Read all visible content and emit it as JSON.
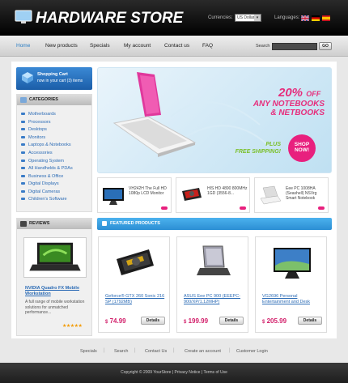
{
  "header": {
    "title": "HARDWARE STORE",
    "currencies_label": "Currencies:",
    "currency_value": "US Dollar",
    "languages_label": "Languages:"
  },
  "nav": {
    "items": [
      "Home",
      "New products",
      "Specials",
      "My account",
      "Contact us",
      "FAQ"
    ],
    "search_label": "Search",
    "search_button": "GO"
  },
  "cart": {
    "title": "Shopping Cart",
    "subtitle": "now in your cart (3) items"
  },
  "categories": {
    "title": "CATEGORIES",
    "items": [
      "Motherboards",
      "Processors",
      "Desktops",
      "Monitors",
      "Laptops & Notebooks",
      "Accessories",
      "Operating System",
      "All Handhelds & PDAs",
      "Business & Office",
      "Digital Displays",
      "Digital Cameras",
      "Children's Software"
    ]
  },
  "reviews": {
    "title": "REVIEWS",
    "product_title": "NVIDIA Quadro FX Mobile Workstation",
    "text": "A full range of mobile workstation solutions for unmatched performance...",
    "stars": "★★★★★"
  },
  "banner": {
    "percent": "20%",
    "off": "OFF",
    "line1": "ANY NOTEBOOKS",
    "line2": "& NETBOOKS",
    "free_line1": "PLUS",
    "free_line2": "FREE SHIPPING!",
    "shop_now": "SHOP NOW!"
  },
  "mini_products": [
    {
      "text": "VH242H The Full HD 1080p LCD Monitor"
    },
    {
      "text": "HIS HD 4890 800MHz 1GD (3556-8..."
    },
    {
      "text": "Eee PC 1008HA (Seashell) NSVrg Smart Notebook"
    }
  ],
  "featured": {
    "title": "FEATURED PRODUCTS",
    "details_label": "Details",
    "products": [
      {
        "name": "Geforce® GTX 260 Sonic 216 SP (1792MB)",
        "currency": "$",
        "price": "74.99"
      },
      {
        "name": "ASUS Eee PC 900 (EEEPC-900/XP/1.12MHP)",
        "currency": "$",
        "price": "199.99"
      },
      {
        "name": "VG2696 Personal Entertainment and Desk",
        "currency": "$",
        "price": "205.99"
      }
    ]
  },
  "footer": {
    "links": [
      "Specials",
      "Search",
      "Contact Us",
      "Create an account",
      "Customer Login"
    ],
    "separator": "|",
    "copyright": "Copyright © 2009 YourStore  |  Privacy Notice  |  Terms of Use"
  }
}
